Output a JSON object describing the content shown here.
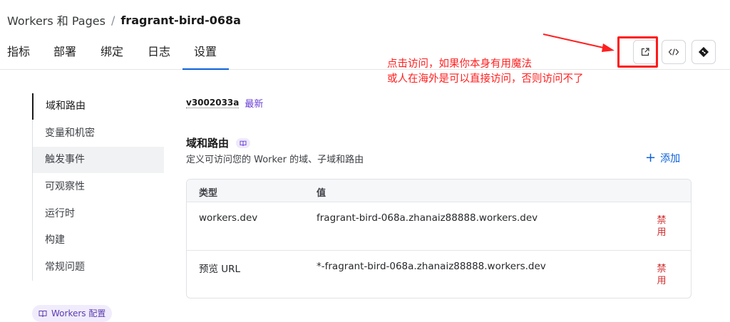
{
  "breadcrumb": {
    "parent": "Workers 和 Pages",
    "separator": "/",
    "current": "fragrant-bird-068a"
  },
  "tabs": [
    {
      "label": "指标"
    },
    {
      "label": "部署"
    },
    {
      "label": "绑定"
    },
    {
      "label": "日志"
    },
    {
      "label": "设置",
      "active": true
    }
  ],
  "toolbar": {
    "icons": [
      "external-link-icon",
      "code-icon",
      "git-icon"
    ]
  },
  "annotation": {
    "line1": "点击访问，如果你本身有用魔法",
    "line2": "或人在海外是可以直接访问，否则访问不了",
    "color": "#ff1f1f"
  },
  "sidenav": {
    "items": [
      {
        "label": "域和路由",
        "active": true
      },
      {
        "label": "变量和机密"
      },
      {
        "label": "触发事件",
        "hover": true
      },
      {
        "label": "可观察性"
      },
      {
        "label": "运行时"
      },
      {
        "label": "构建"
      },
      {
        "label": "常规问题"
      }
    ],
    "footer_pill": "Workers 配置"
  },
  "version": {
    "id": "v3002033a",
    "tag": "最新"
  },
  "domains": {
    "title": "域和路由",
    "description": "定义可访问您的 Worker 的域、子域和路由",
    "add_label": "添加",
    "columns": [
      "类型",
      "值"
    ],
    "rows": [
      {
        "type": "workers.dev",
        "value": "fragrant-bird-068a.zhanaiz88888.workers.dev",
        "action": "禁用"
      },
      {
        "type": "预览 URL",
        "value": "*-fragrant-bird-068a.zhanaiz88888.workers.dev",
        "action": "禁用"
      }
    ]
  },
  "colors": {
    "accent": "#0b61d8",
    "purple": "#6a3fd6",
    "danger": "#d12b2b"
  }
}
